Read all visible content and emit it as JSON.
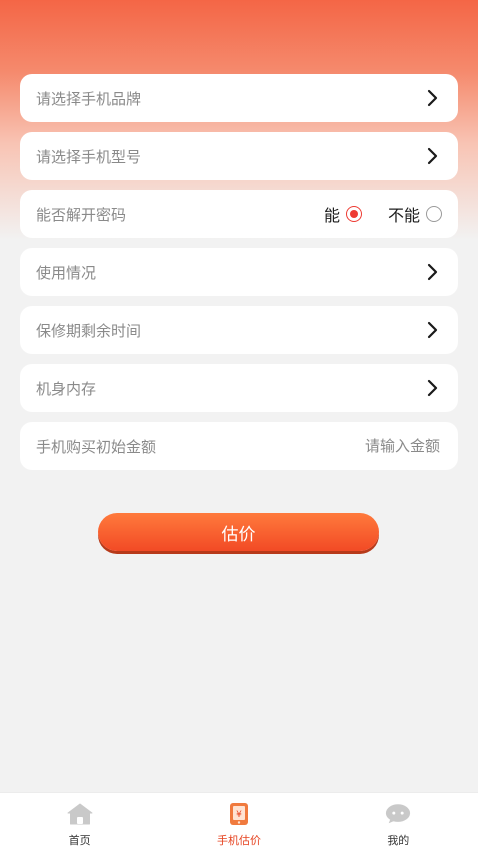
{
  "form": {
    "brand": {
      "label": "请选择手机品牌"
    },
    "model": {
      "label": "请选择手机型号"
    },
    "unlock": {
      "label": "能否解开密码",
      "options": [
        "能",
        "不能"
      ],
      "selected": 0
    },
    "usage": {
      "label": "使用情况"
    },
    "warranty": {
      "label": "保修期剩余时间"
    },
    "storage": {
      "label": "机身内存"
    },
    "price": {
      "label": "手机购买初始金额",
      "placeholder": "请输入金额"
    }
  },
  "estimate_button": "估价",
  "tabbar": {
    "items": [
      {
        "label": "首页",
        "icon": "home-icon"
      },
      {
        "label": "手机估价",
        "icon": "phone-price-icon"
      },
      {
        "label": "我的",
        "icon": "chat-icon"
      }
    ],
    "active_index": 1
  },
  "colors": {
    "accent": "#f24a25",
    "active_tab": "#e6421f"
  }
}
